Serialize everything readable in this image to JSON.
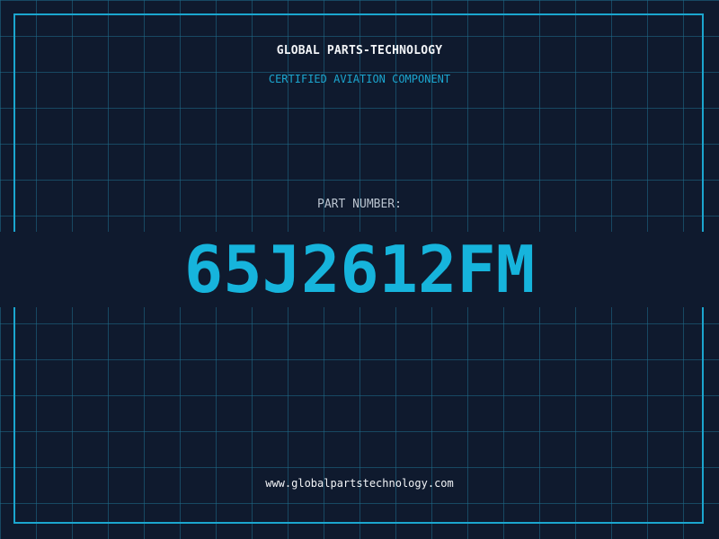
{
  "header": {
    "company": "GLOBAL PARTS-TECHNOLOGY",
    "subtitle": "CERTIFIED AVIATION COMPONENT"
  },
  "part": {
    "label": "PART NUMBER:",
    "number": "65J2612FM"
  },
  "footer": {
    "url": "www.globalpartstechnology.com"
  },
  "colors": {
    "background": "#0f1a2e",
    "grid": "#1e6e8c",
    "accent": "#1ba6cf",
    "text": "#f2f4f7"
  }
}
